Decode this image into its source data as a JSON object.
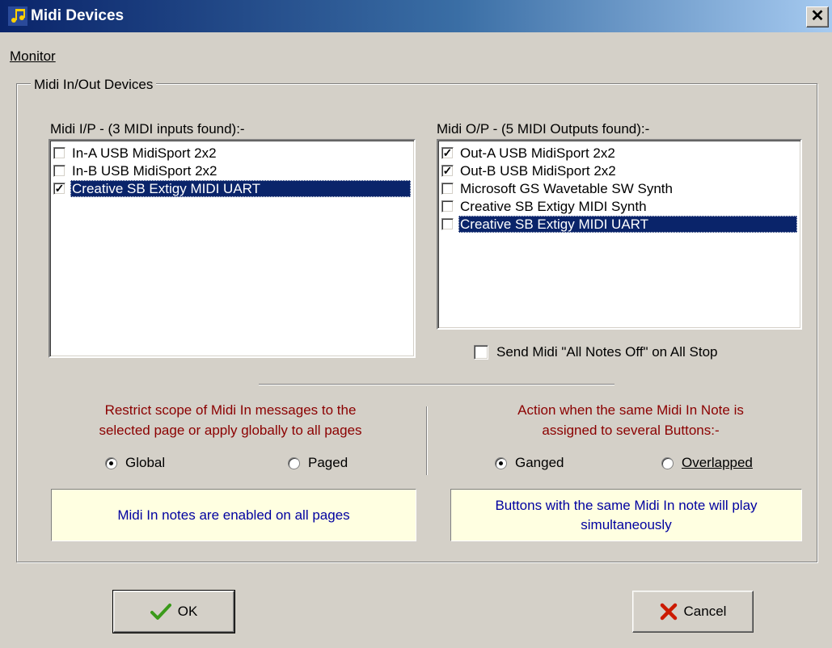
{
  "window": {
    "title": "Midi Devices",
    "close_label": "✕"
  },
  "menu": {
    "items": [
      {
        "label": "Monitor"
      }
    ]
  },
  "group": {
    "label": "Midi In/Out Devices"
  },
  "inputs": {
    "heading": "Midi I/P - (3 MIDI inputs found):-",
    "items": [
      {
        "label": "In-A USB MidiSport 2x2",
        "checked": false,
        "selected": false
      },
      {
        "label": "In-B USB MidiSport 2x2",
        "checked": false,
        "selected": false
      },
      {
        "label": "Creative SB Extigy MIDI UART",
        "checked": true,
        "selected": true
      }
    ]
  },
  "outputs": {
    "heading": "Midi O/P - (5 MIDI Outputs found):-",
    "items": [
      {
        "label": "Out-A USB MidiSport 2x2",
        "checked": true,
        "selected": false
      },
      {
        "label": "Out-B USB MidiSport 2x2",
        "checked": true,
        "selected": false
      },
      {
        "label": "Microsoft GS Wavetable SW Synth",
        "checked": false,
        "selected": false
      },
      {
        "label": "Creative SB Extigy MIDI Synth",
        "checked": false,
        "selected": false
      },
      {
        "label": "Creative SB Extigy MIDI UART",
        "checked": false,
        "selected": true
      }
    ]
  },
  "all_notes_off": {
    "label": "Send Midi \"All Notes Off\" on All Stop",
    "checked": false
  },
  "scope": {
    "description_line1": "Restrict scope of Midi In messages to the",
    "description_line2": "selected page or apply globally to all pages",
    "options": [
      {
        "label": "Global",
        "selected": true
      },
      {
        "label": "Paged",
        "selected": false
      }
    ],
    "info": "Midi In notes are enabled on all pages"
  },
  "action": {
    "description_line1": "Action when the same Midi In Note is",
    "description_line2": "assigned to several Buttons:-",
    "options": [
      {
        "label": "Ganged",
        "selected": true
      },
      {
        "label": "Overlapped",
        "selected": false
      }
    ],
    "info": "Buttons with the same Midi In note will play simultaneously"
  },
  "buttons": {
    "ok_label": "OK",
    "cancel_label": "Cancel"
  },
  "colors": {
    "title_bar": "#0a246a",
    "selection": "#0a246a",
    "description_text": "#8b0000",
    "info_background": "#ffffe1",
    "info_text": "#0000a0",
    "ok_check": "#3a9a1a",
    "cancel_x": "#cc1a00"
  }
}
